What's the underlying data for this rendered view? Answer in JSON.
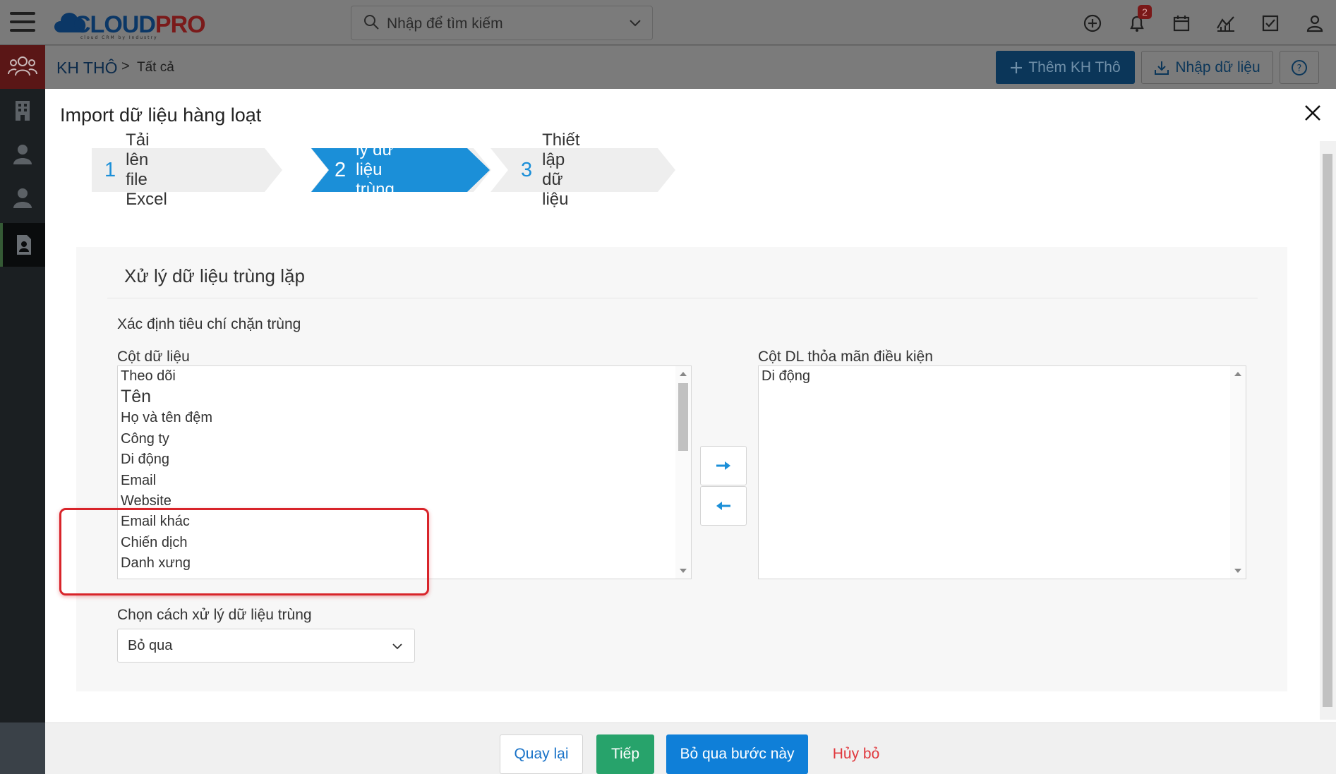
{
  "topbar": {
    "logo_main": "CLOUD",
    "logo_accent": "PRO",
    "logo_tagline": "cloud CRM by Industry",
    "search_placeholder": "Nhập để tìm kiếm",
    "notification_count": "2"
  },
  "breadcrumb": {
    "module": "KH THÔ",
    "separator": ">",
    "view": "Tất cả"
  },
  "header_actions": {
    "add_label": "Thêm KH Thô",
    "import_label": "Nhập dữ liệu"
  },
  "modal": {
    "title": "Import dữ liệu hàng loạt",
    "steps": [
      {
        "num": "1",
        "label": "Tải lên file Excel"
      },
      {
        "num": "2",
        "label": "Xử lý dữ liệu trùng lặp"
      },
      {
        "num": "3",
        "label": "Thiết lập dữ liệu"
      }
    ],
    "active_step": 2
  },
  "panel": {
    "title": "Xử lý dữ liệu trùng lặp",
    "criteria_label": "Xác định tiêu chí chặn trùng",
    "left_list_label": "Cột dữ liệu",
    "right_list_label": "Cột DL thỏa mãn điều kiện",
    "left_items": [
      "Theo dõi",
      "Tên",
      "Họ và tên đệm",
      "Công ty",
      "Di động",
      "Email",
      "Website",
      "Email khác",
      "Chiến dịch",
      "Danh xưng"
    ],
    "right_items": [
      "Di động"
    ],
    "dup_handling_label": "Chọn cách xử lý dữ liệu trùng",
    "dup_handling_value": "Bỏ qua"
  },
  "footer": {
    "back": "Quay lại",
    "next": "Tiếp",
    "skip": "Bỏ qua bước này",
    "cancel": "Hủy bỏ"
  },
  "colors": {
    "active_step": "#1b8fd8",
    "inactive_step": "#eeeeee",
    "highlight": "#d8242a",
    "next_button": "#27a36b",
    "skip_button": "#0f7fd8",
    "cancel_text": "#e0373c"
  }
}
